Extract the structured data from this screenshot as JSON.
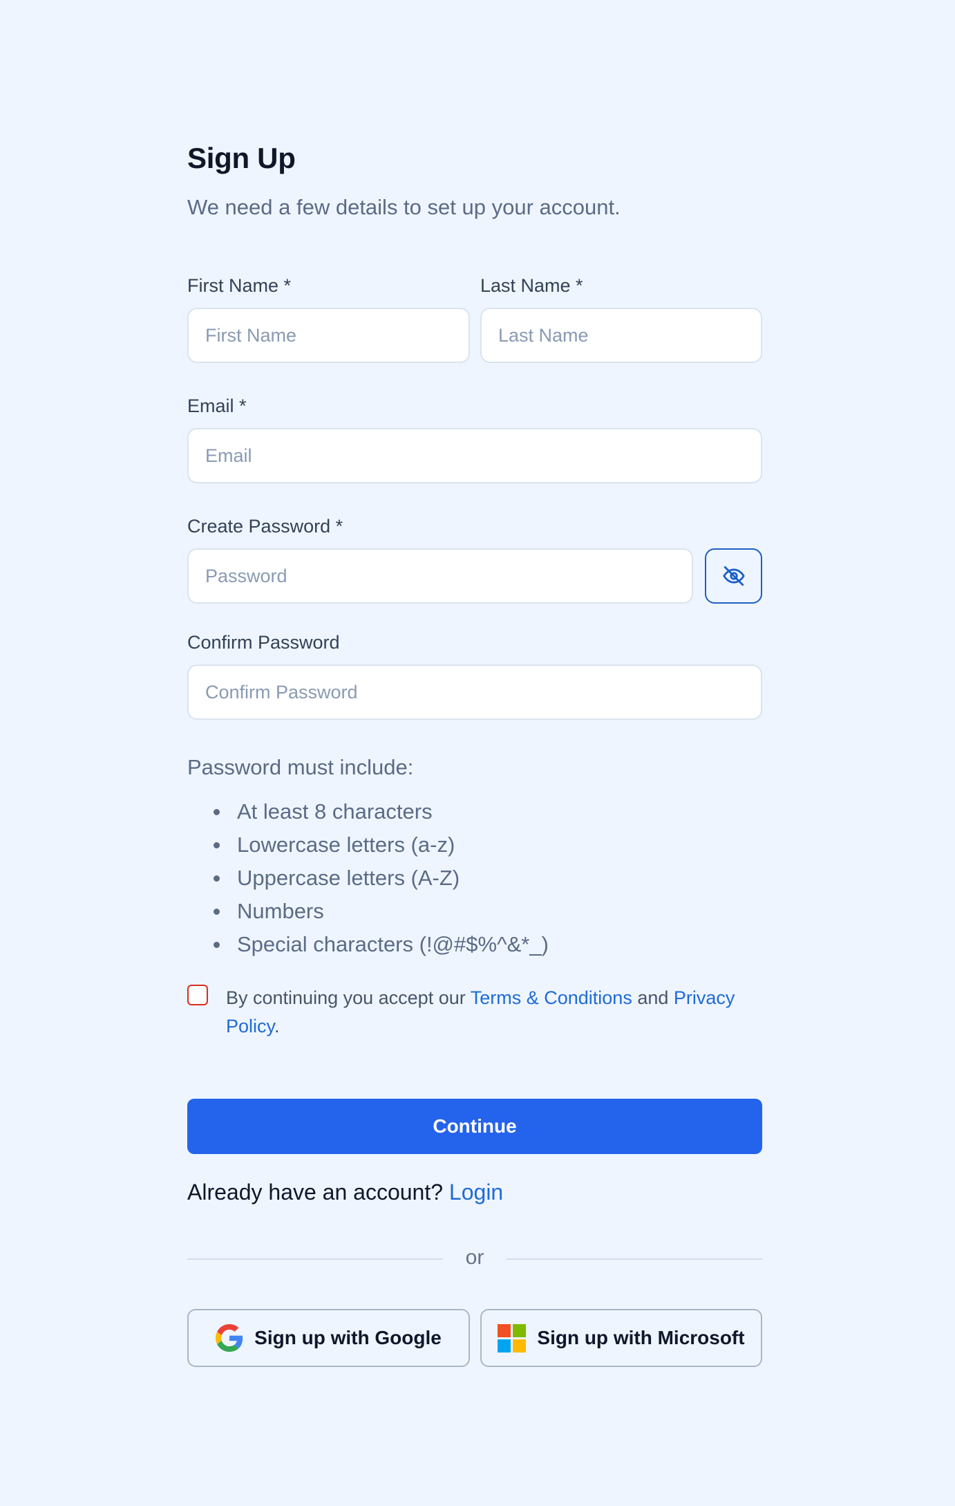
{
  "header": {
    "title": "Sign Up",
    "subtitle": "We need a few details to set up your account."
  },
  "fields": {
    "first_name": {
      "label": "First Name *",
      "placeholder": "First Name",
      "value": ""
    },
    "last_name": {
      "label": "Last Name *",
      "placeholder": "Last Name",
      "value": ""
    },
    "email": {
      "label": "Email *",
      "placeholder": "Email",
      "value": ""
    },
    "password": {
      "label": "Create Password *",
      "placeholder": "Password",
      "value": ""
    },
    "confirm_password": {
      "label": "Confirm Password",
      "placeholder": "Confirm Password",
      "value": ""
    }
  },
  "password_rules": {
    "title": "Password must include:",
    "items": [
      "At least 8 characters",
      "Lowercase letters (a-z)",
      "Uppercase letters (A-Z)",
      "Numbers",
      "Special characters (!@#$%^&*_)"
    ]
  },
  "terms": {
    "checked": false,
    "prefix": "By continuing you accept our ",
    "terms_link": "Terms & Conditions",
    "middle": " and ",
    "privacy_link": "Privacy Policy",
    "suffix": "."
  },
  "actions": {
    "continue_label": "Continue",
    "login_prompt": "Already have an account? ",
    "login_link": "Login",
    "divider": "or",
    "google_label": "Sign up with Google",
    "microsoft_label": "Sign up with Microsoft"
  },
  "icons": {
    "password_toggle": "eye-off-icon",
    "google": "google-logo-icon",
    "microsoft": "microsoft-logo-icon"
  },
  "colors": {
    "background": "#eef5ff",
    "primary": "#2463eb",
    "link": "#1e6bd6",
    "checkbox_border": "#d92d20"
  }
}
